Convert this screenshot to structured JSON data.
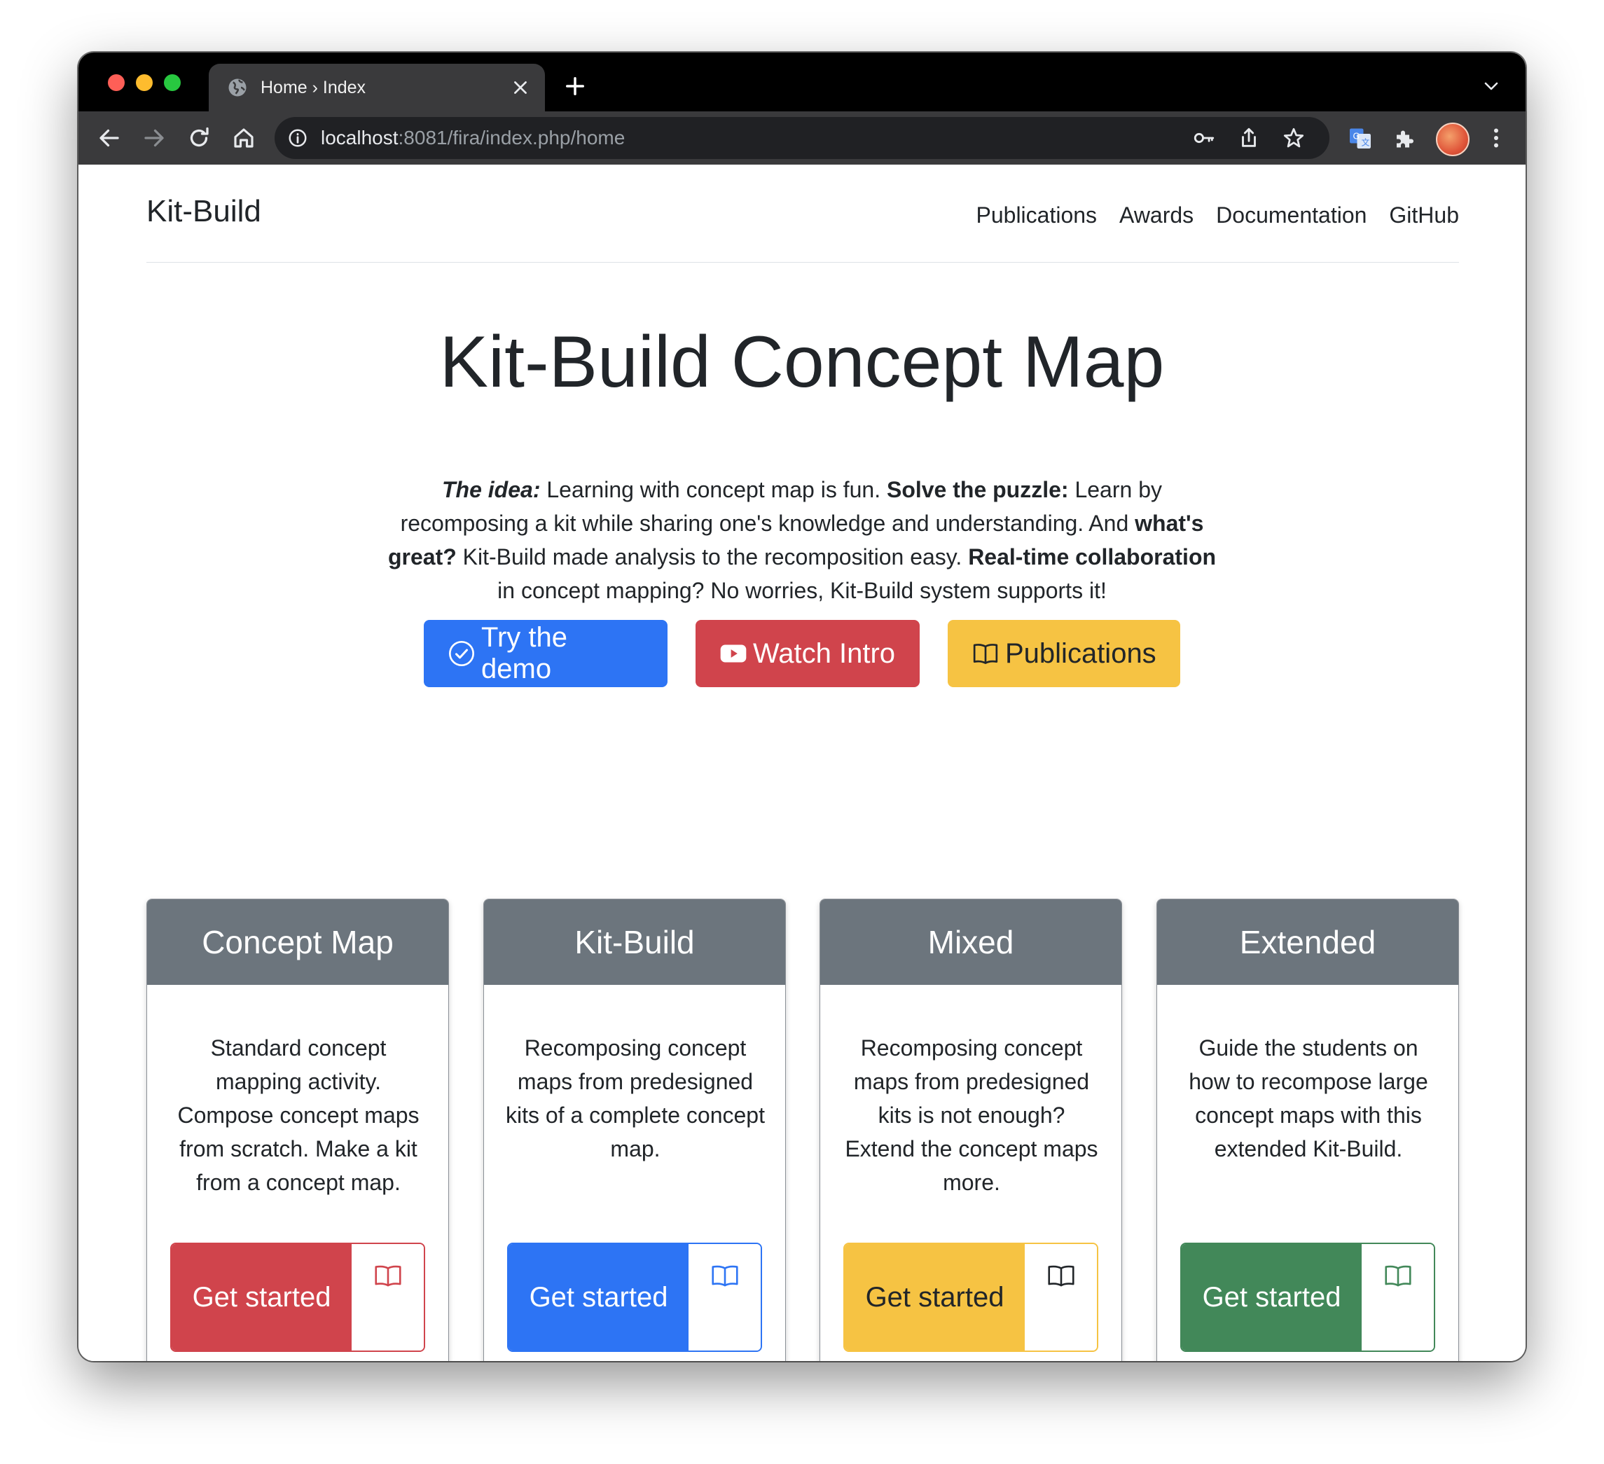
{
  "browser": {
    "tab_title": "Home › Index",
    "url_host": "localhost",
    "url_rest": ":8081/fira/index.php/home"
  },
  "nav": {
    "brand": "Kit-Build",
    "links": [
      "Publications",
      "Awards",
      "Documentation",
      "GitHub"
    ]
  },
  "hero": {
    "title": "Kit-Build Concept Map",
    "lead": {
      "idea_label": "The idea:",
      "idea_text": " Learning with concept map is fun. ",
      "solve_label": "Solve the puzzle:",
      "solve_text": " Learn by recomposing a kit while sharing one's knowledge and understanding. And ",
      "great_label": "what's great?",
      "great_text": " Kit-Build made analysis to the recomposition easy. ",
      "collab_label": "Real-time collaboration",
      "collab_text": " in concept mapping? No worries, Kit-Build system supports it!"
    },
    "buttons": {
      "demo": "Try the demo",
      "intro": "Watch Intro",
      "publications": "Publications"
    }
  },
  "cards": [
    {
      "title": "Concept Map",
      "text": "Standard concept mapping activity. Compose concept maps from scratch. Make a kit from a concept map.",
      "button": "Get started",
      "color": "#d0444c"
    },
    {
      "title": "Kit-Build",
      "text": "Recomposing concept maps from predesigned kits of a complete concept map.",
      "button": "Get started",
      "color": "#2d74f4"
    },
    {
      "title": "Mixed",
      "text": "Recomposing concept maps from predesigned kits is not enough? Extend the concept maps more.",
      "button": "Get started",
      "color": "#f6c343"
    },
    {
      "title": "Extended",
      "text": "Guide the students on how to recompose large concept maps with this extended Kit-Build.",
      "button": "Get started",
      "color": "#428859"
    }
  ]
}
